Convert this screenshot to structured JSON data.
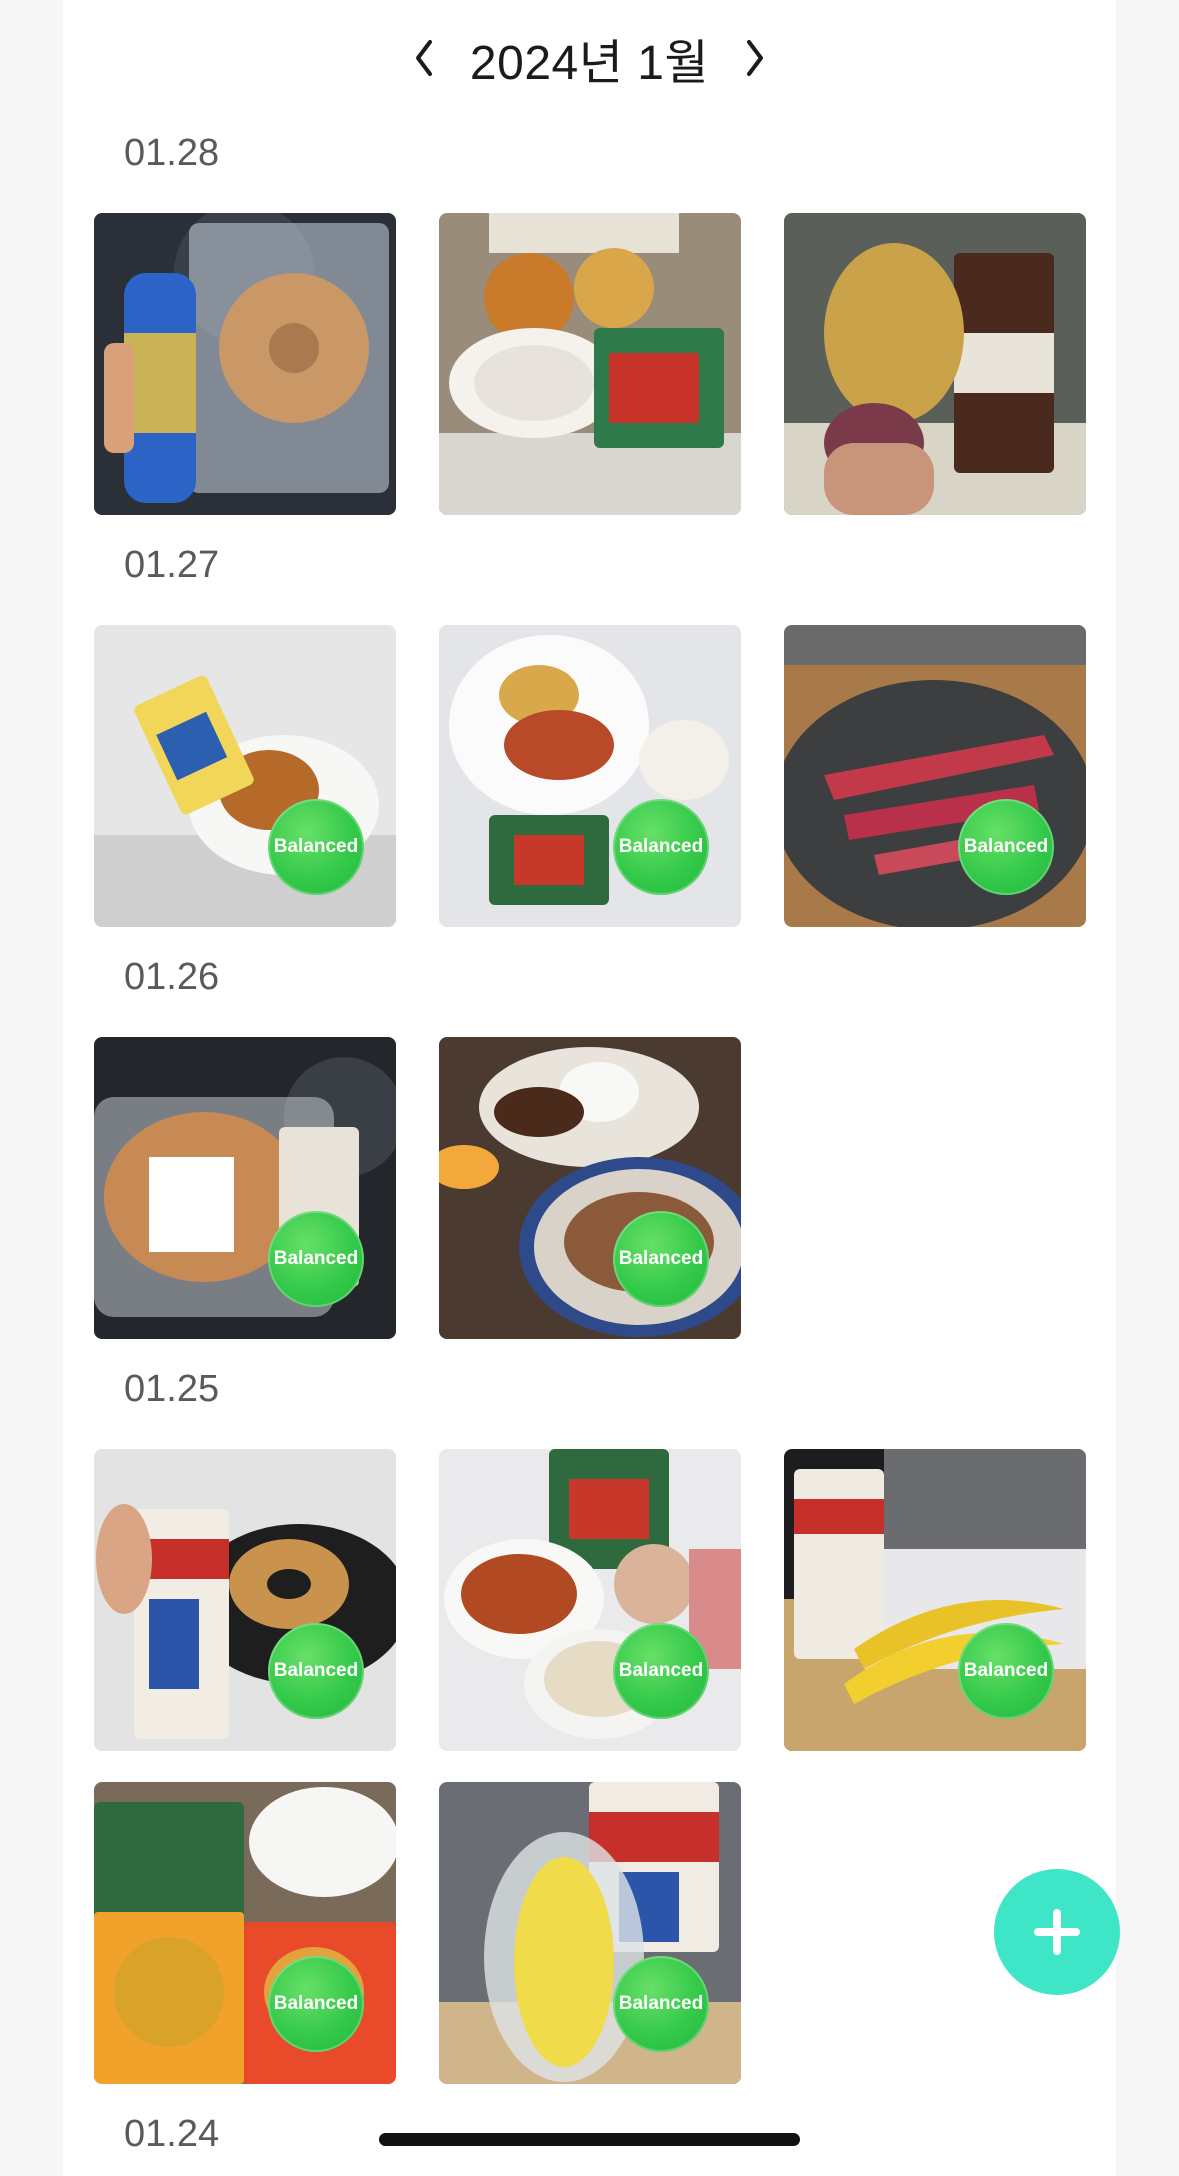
{
  "header": {
    "title": "2024년 1월",
    "prev_icon": "chevron-left-icon",
    "next_icon": "chevron-right-icon"
  },
  "days": [
    {
      "date": "01.28",
      "meals": [
        {
          "photo": "protein drink and bagel in car",
          "badge": ""
        },
        {
          "photo": "rice bowl and packaged foods on desk",
          "badge": ""
        },
        {
          "photo": "roasted sweet potato and protein drink",
          "badge": ""
        }
      ]
    },
    {
      "date": "01.27",
      "meals": [
        {
          "photo": "protein drink and bagel on plate",
          "badge": "Balanced"
        },
        {
          "photo": "chicken on paper plate with kimchi",
          "badge": "Balanced"
        },
        {
          "photo": "raw beef on stone plate",
          "badge": "Balanced"
        }
      ]
    },
    {
      "date": "01.26",
      "meals": [
        {
          "photo": "bagel in bag with protein drink",
          "badge": "Balanced"
        },
        {
          "photo": "rice, meat and orange on table",
          "badge": "Balanced"
        }
      ]
    },
    {
      "date": "01.25",
      "meals": [
        {
          "photo": "protein drink and bagel on black plate",
          "badge": "Balanced"
        },
        {
          "photo": "chicken, rice porridge and packages",
          "badge": "Balanced"
        },
        {
          "photo": "protein drink and bananas on desk",
          "badge": "Balanced"
        },
        {
          "photo": "packaged chicken breast and rice",
          "badge": "Balanced"
        },
        {
          "photo": "corn in plastic and protein drink",
          "badge": "Balanced"
        }
      ]
    },
    {
      "date": "01.24",
      "meals": []
    }
  ],
  "fab": {
    "icon": "plus-icon"
  },
  "colors": {
    "badge": "#34c94a",
    "fab": "#3ee6c7",
    "background": "#f6f6f7",
    "page": "#ffffff"
  }
}
